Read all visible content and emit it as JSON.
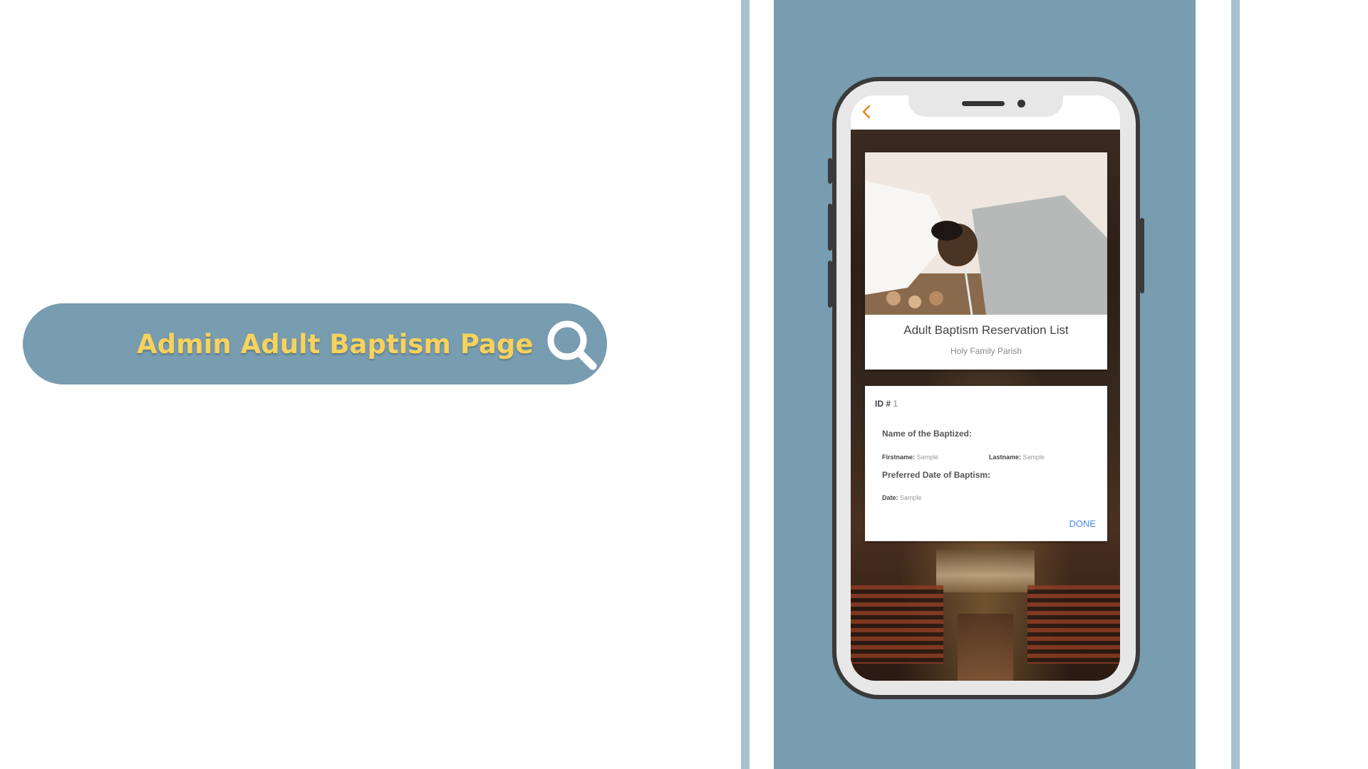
{
  "search": {
    "label": "Admin Adult Baptism Page"
  },
  "app": {
    "header": {
      "title": "Adult Baptism Reservation List",
      "subtitle": "Holy Family Parish"
    },
    "record": {
      "id_label": "ID #",
      "id_value": "1",
      "name_section": "Name of the Baptized:",
      "firstname_label": "Firstname:",
      "firstname_value": "Sample",
      "lastname_label": "Lastname:",
      "lastname_value": "Sample",
      "date_section": "Preferred Date of Baptism:",
      "date_label": "Date:",
      "date_value": "Sample",
      "done_label": "DONE"
    }
  },
  "icons": {
    "search": "search-icon",
    "back": "chevron-left-icon"
  },
  "colors": {
    "panel": "#789cb0",
    "stripe": "#a9c0cf",
    "search_text": "#f7d25c",
    "back_icon": "#e8841c",
    "done": "#4a8ee0"
  }
}
